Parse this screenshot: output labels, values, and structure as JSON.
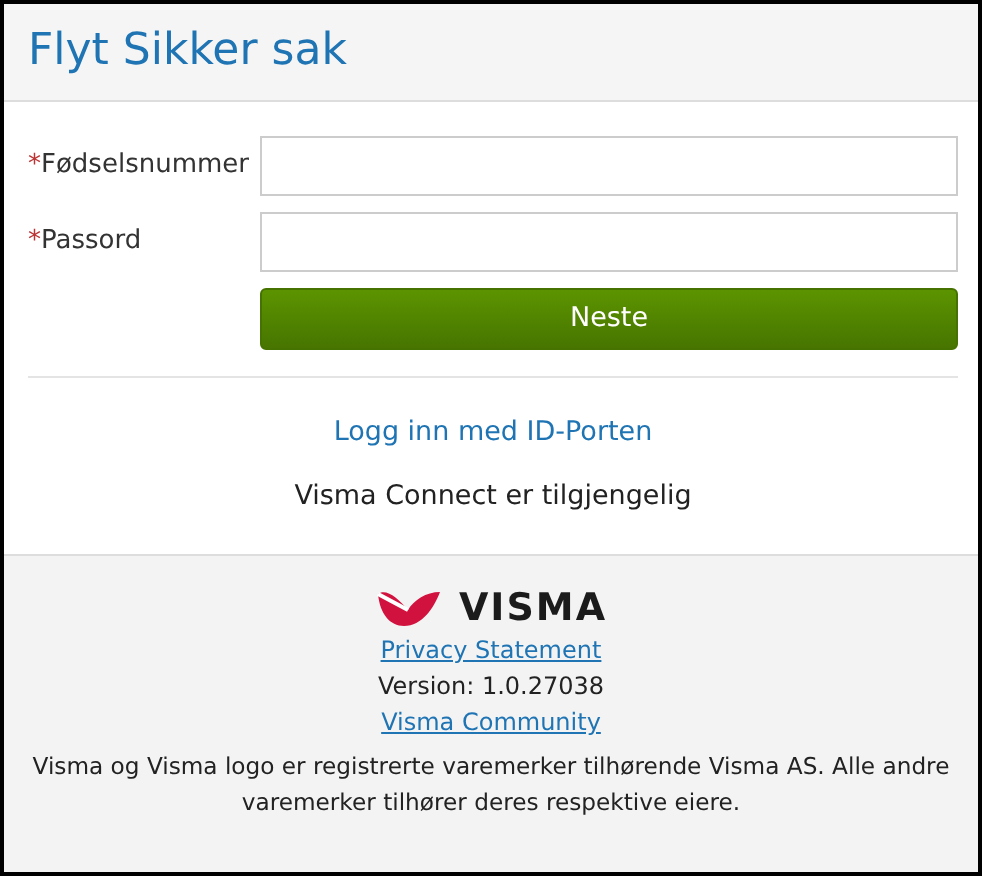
{
  "title": "Flyt Sikker sak",
  "fields": [
    {
      "required_mark": "*",
      "label": "Fødselsnummer",
      "required": true
    },
    {
      "required_mark": "*",
      "label": "Passord",
      "required": true
    }
  ],
  "submit_button": "Neste",
  "id_porten_link": "Logg inn med ID-Porten",
  "connect_note": "Visma Connect er tilgjengelig",
  "footer": {
    "logo_text": "VISMA",
    "privacy_link": "Privacy Statement",
    "version": "Version: 1.0.27038",
    "community_link": "Visma Community",
    "disclaimer": "Visma og Visma logo er registrerte varemerker tilhørende Visma AS. Alle andre varemerker tilhører deres respektive eiere."
  }
}
